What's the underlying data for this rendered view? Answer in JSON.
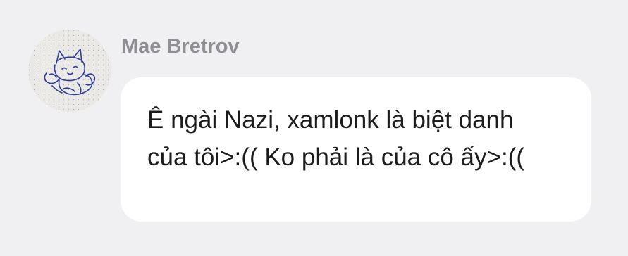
{
  "message": {
    "sender": {
      "name": "Mae Bretrov",
      "avatar_icon": "cat-sketch-avatar-icon"
    },
    "text": "Ê ngài Nazi, xamlonk là biệt danh của tôi>:(( Ko phải là của cô ấy>:(("
  },
  "colors": {
    "background": "#f0f0f2",
    "bubble": "#ffffff",
    "sender_name": "#8e8e93",
    "message_text": "#1c1c1e",
    "avatar_ink": "#2f3c9e"
  }
}
